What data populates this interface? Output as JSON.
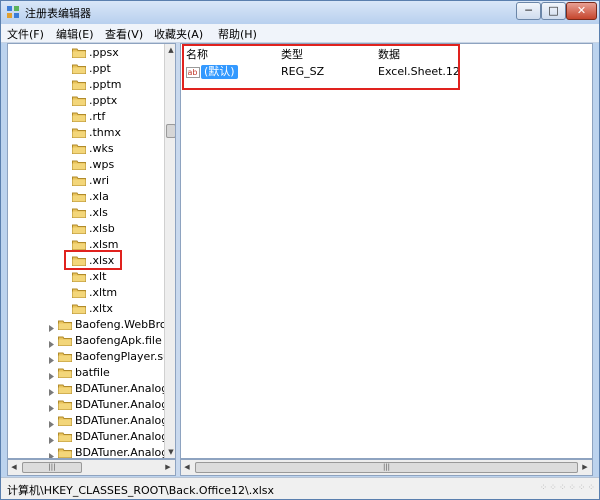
{
  "window": {
    "title": "注册表编辑器",
    "min_glyph": "─",
    "max_glyph": "□",
    "close_glyph": "✕"
  },
  "menu": {
    "items": [
      "文件(F)",
      "编辑(E)",
      "查看(V)",
      "收藏夹(A)",
      "帮助(H)"
    ]
  },
  "tree": {
    "extensions": [
      ".ppsx",
      ".ppt",
      ".pptm",
      ".pptx",
      ".rtf",
      ".thmx",
      ".wks",
      ".wps",
      ".wri",
      ".xla",
      ".xls",
      ".xlsb",
      ".xlsm",
      ".xlsx",
      ".xlt",
      ".xltm",
      ".xltx"
    ],
    "keys": [
      "Baofeng.WebBrow",
      "BaofengApk.file",
      "BaofengPlayer.sup",
      "batfile",
      "BDATuner.AnalogA",
      "BDATuner.AnalogA",
      "BDATuner.AnalogL",
      "BDATuner.AnalogL",
      "BDATuner.AnalogR"
    ],
    "highlighted": ".xlsx",
    "scroll_up": "▲",
    "scroll_down": "▼",
    "scroll_left": "◀",
    "scroll_right": "▶",
    "grip": "|||"
  },
  "list": {
    "headers": {
      "name": "名称",
      "type": "类型",
      "data": "数据"
    },
    "values": [
      {
        "icon": "ab",
        "name": "(默认)",
        "type": "REG_SZ",
        "data": "Excel.Sheet.12"
      }
    ]
  },
  "status": {
    "path": "计算机\\HKEY_CLASSES_ROOT\\Back.Office12\\.xlsx"
  },
  "colors": {
    "highlight_box": "#e0221e",
    "selection": "#3399ff",
    "folder": "#e8c25a"
  }
}
